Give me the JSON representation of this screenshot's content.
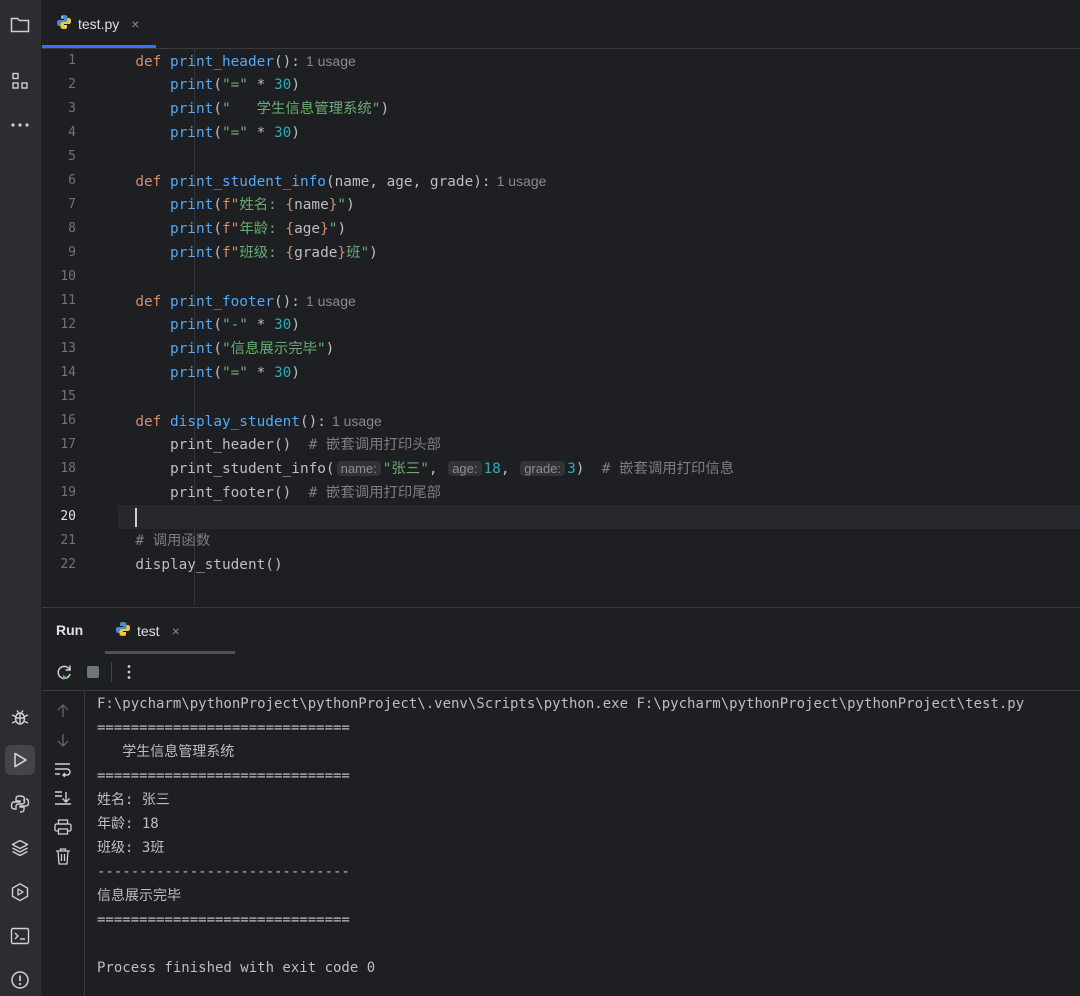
{
  "editor_tab": {
    "label": "test.py",
    "close": "×"
  },
  "code_lines": [
    {
      "n": "1"
    },
    {
      "n": "2"
    },
    {
      "n": "3"
    },
    {
      "n": "4"
    },
    {
      "n": "5"
    },
    {
      "n": "6"
    },
    {
      "n": "7"
    },
    {
      "n": "8"
    },
    {
      "n": "9"
    },
    {
      "n": "10"
    },
    {
      "n": "11"
    },
    {
      "n": "12"
    },
    {
      "n": "13"
    },
    {
      "n": "14"
    },
    {
      "n": "15"
    },
    {
      "n": "16"
    },
    {
      "n": "17"
    },
    {
      "n": "18"
    },
    {
      "n": "19"
    },
    {
      "n": "20"
    },
    {
      "n": "21"
    },
    {
      "n": "22"
    }
  ],
  "code": {
    "l1": {
      "kw": "def",
      "fn": "print_header",
      "tail": "():",
      "hint": "1 usage"
    },
    "l2": {
      "call": "print",
      "open": "(",
      "s": "\"=\"",
      "op": " * ",
      "num": "30",
      "close": ")"
    },
    "l3": {
      "call": "print",
      "open": "(",
      "s": "\"   学生信息管理系统\"",
      "close": ")"
    },
    "l4": {
      "call": "print",
      "open": "(",
      "s": "\"=\"",
      "op": " * ",
      "num": "30",
      "close": ")"
    },
    "l6": {
      "kw": "def",
      "fn": "print_student_info",
      "tail": "(name, age, grade):",
      "hint": "1 usage"
    },
    "l7": {
      "call": "print",
      "open": "(",
      "f": "f\"",
      "s1": "姓名: ",
      "b1": "{",
      "v": "name",
      "b2": "}",
      "q": "\"",
      "close": ")"
    },
    "l8": {
      "call": "print",
      "open": "(",
      "f": "f\"",
      "s1": "年龄: ",
      "b1": "{",
      "v": "age",
      "b2": "}",
      "q": "\"",
      "close": ")"
    },
    "l9": {
      "call": "print",
      "open": "(",
      "f": "f\"",
      "s1": "班级: ",
      "b1": "{",
      "v": "grade",
      "b2": "}",
      "s2": "班",
      "q": "\"",
      "close": ")"
    },
    "l11": {
      "kw": "def",
      "fn": "print_footer",
      "tail": "():",
      "hint": "1 usage"
    },
    "l12": {
      "call": "print",
      "open": "(",
      "s": "\"-\"",
      "op": " * ",
      "num": "30",
      "close": ")"
    },
    "l13": {
      "call": "print",
      "open": "(",
      "s": "\"信息展示完毕\"",
      "close": ")"
    },
    "l14": {
      "call": "print",
      "open": "(",
      "s": "\"=\"",
      "op": " * ",
      "num": "30",
      "close": ")"
    },
    "l16": {
      "kw": "def",
      "fn": "display_student",
      "tail": "():",
      "hint": "1 usage"
    },
    "l17": {
      "code": "print_header()",
      "cmt": "# 嵌套调用打印头部"
    },
    "l18": {
      "code": "print_student_info(",
      "h1": "name:",
      "s": "\"张三\"",
      "comma1": ",",
      "h2": "age:",
      "n1": "18",
      "comma2": ",",
      "h3": "grade:",
      "n2": "3",
      "close": ")",
      "cmt": "# 嵌套调用打印信息"
    },
    "l19": {
      "code": "print_footer()",
      "cmt": "# 嵌套调用打印尾部"
    },
    "l21": {
      "cmt": "# 调用函数"
    },
    "l22": {
      "code": "display_student()"
    }
  },
  "run": {
    "title": "Run",
    "tab_label": "test",
    "tab_close": "×",
    "console": [
      "F:\\pycharm\\pythonProject\\pythonProject\\.venv\\Scripts\\python.exe F:\\pycharm\\pythonProject\\pythonProject\\test.py",
      "==============================",
      "   学生信息管理系统",
      "==============================",
      "姓名: 张三",
      "年龄: 18",
      "班级: 3班",
      "------------------------------",
      "信息展示完毕",
      "==============================",
      "",
      "Process finished with exit code 0"
    ]
  },
  "icons": {
    "sidebar_top": [
      "folder-icon",
      "structure-icon",
      "more-icon"
    ],
    "sidebar_bottom": [
      "debug-icon",
      "run-icon",
      "python-console-icon",
      "layers-icon",
      "services-icon",
      "terminal-icon",
      "problems-icon"
    ],
    "run_toolbar": [
      "rerun-icon",
      "stop-icon",
      "more-vertical-icon"
    ],
    "run_side": [
      "arrow-up-icon",
      "arrow-down-icon",
      "soft-wrap-icon",
      "scroll-to-end-icon",
      "print-icon",
      "trash-icon"
    ]
  },
  "colors": {
    "background": "#1e1f22",
    "keyword": "#cf8e6d",
    "function": "#56a8f5",
    "string": "#6aab73",
    "number": "#2aacb8",
    "comment": "#7a7e85",
    "tab_accent": "#3574f0"
  }
}
